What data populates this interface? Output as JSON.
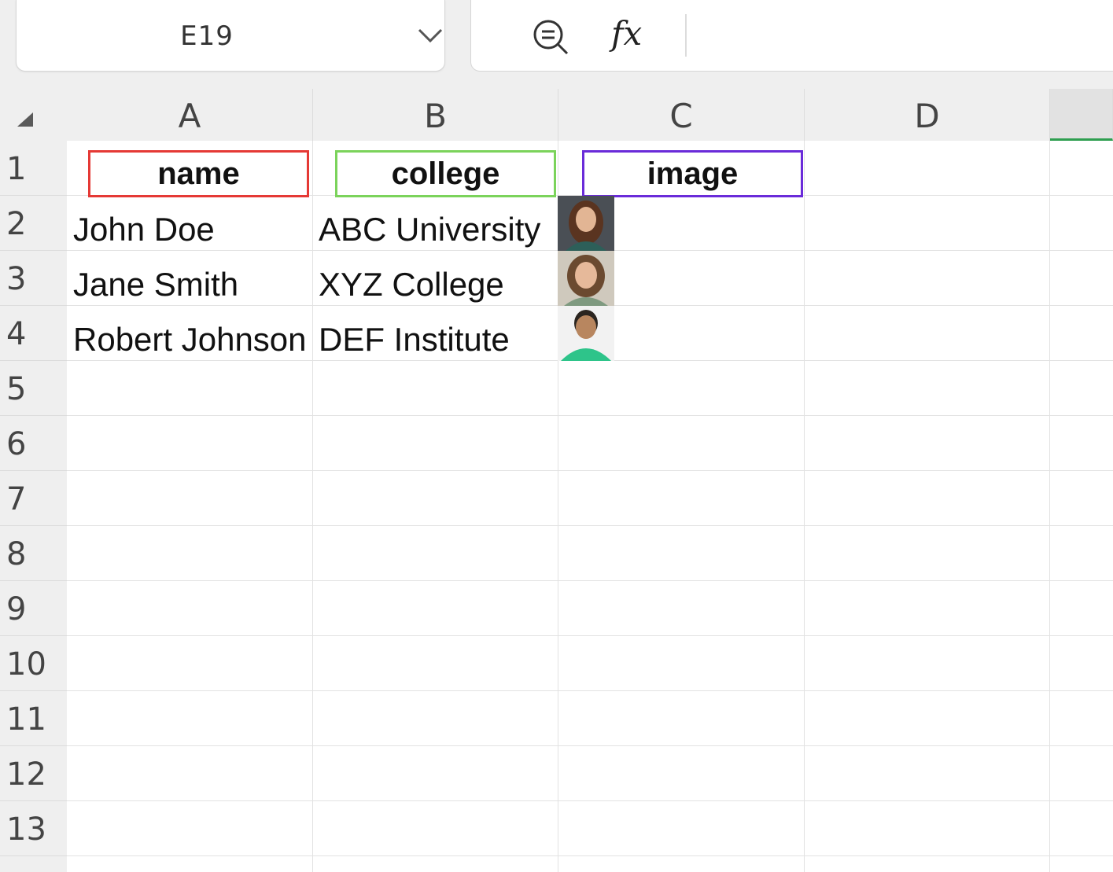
{
  "namebox": {
    "cell_ref": "E19"
  },
  "formula_bar": {
    "fx_label": "fx",
    "value": ""
  },
  "columns": [
    "A",
    "B",
    "C",
    "D"
  ],
  "rows": [
    "1",
    "2",
    "3",
    "4",
    "5",
    "6",
    "7",
    "8",
    "9",
    "10",
    "11",
    "12",
    "13"
  ],
  "headers": {
    "name": {
      "text": "name",
      "border_color": "#e53935"
    },
    "college": {
      "text": "college",
      "border_color": "#7bd35b"
    },
    "image": {
      "text": "image",
      "border_color": "#6a2bd9"
    }
  },
  "records": [
    {
      "name": "John Doe",
      "college": "ABC University",
      "photo": "portrait-woman-long-hair"
    },
    {
      "name": "Jane Smith",
      "college": "XYZ College",
      "photo": "portrait-woman-curly-hair"
    },
    {
      "name": "Robert Johnson",
      "college": "DEF Institute",
      "photo": "portrait-man-green-shirt"
    }
  ],
  "colors": {
    "selected_column_accent": "#2e9e4f"
  }
}
